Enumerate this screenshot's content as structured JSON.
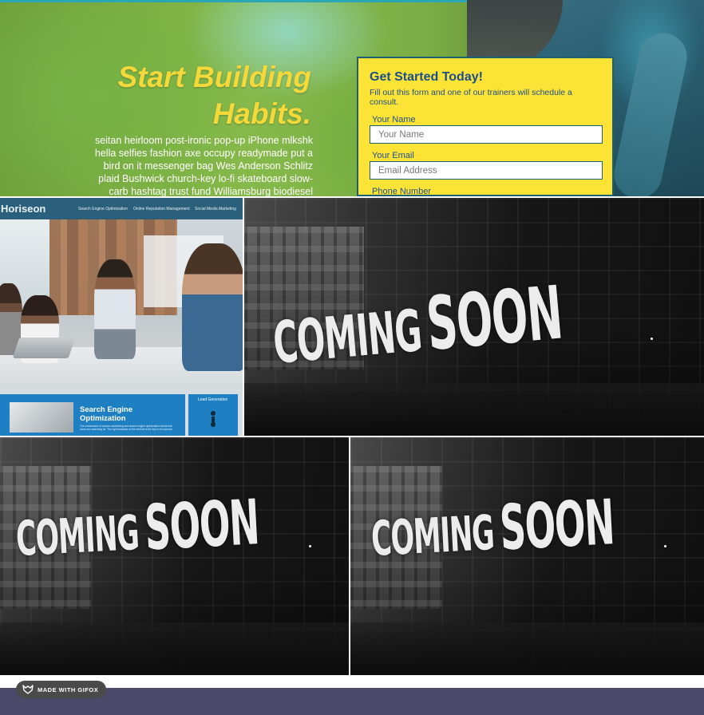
{
  "hero": {
    "title_line1": "Start Building",
    "title_line2": "Habits.",
    "body": "seitan heirloom post-ironic pop-up iPhone mlkshk hella selfies fashion axe occupy readymade put a bird on it messenger bag Wes Anderson Schlitz plaid Bushwick church-key lo-fi skateboard slow-carb hashtag trust fund Williamsburg biodiesel fixie"
  },
  "form": {
    "title": "Get Started Today!",
    "subtitle": "Fill out this form and one of our trainers will schedule a consult.",
    "name_label": "Your Name",
    "name_placeholder": "Your Name",
    "email_label": "Your Email",
    "email_placeholder": "Email Address",
    "phone_label": "Phone Number"
  },
  "horiseon": {
    "logo": "Horiseon",
    "nav": [
      "Search Engine Optimization",
      "Online Reputation Management",
      "Social Media Marketing"
    ],
    "card_title": "Search Engine Optimization",
    "card_text": "The cornerstone of modern advertising and search engine optimization needs that users are searching for. The right business on the internet is the key to its success. Focus on the best keywords.",
    "side_title": "Lead Generation"
  },
  "coming_soon": {
    "word1": "COMING",
    "word2": "SOON"
  },
  "badge": {
    "label": "MADE WITH GIFOX"
  },
  "colors": {
    "accent_yellow": "#f5d93a",
    "form_bg": "#fde336",
    "form_text": "#1b4f8c",
    "horiseon_header": "#2a607c",
    "horiseon_blue": "#1e7fc3",
    "bottom_bar": "#4b4a6b"
  }
}
